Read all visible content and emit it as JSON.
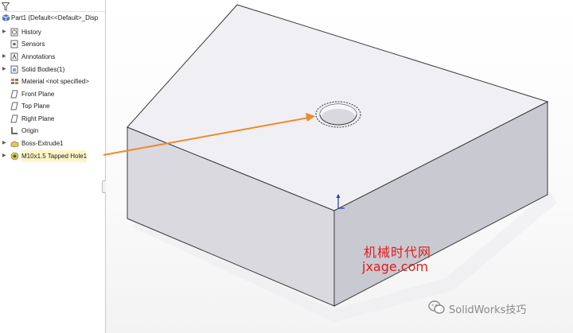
{
  "feature_tree": {
    "root_label": "Part1  (Default<<Default>_Disp",
    "items": [
      {
        "label": "History",
        "icon": "history-icon",
        "expandable": true
      },
      {
        "label": "Sensors",
        "icon": "sensors-icon",
        "expandable": false
      },
      {
        "label": "Annotations",
        "icon": "annotations-icon",
        "expandable": true
      },
      {
        "label": "Solid Bodies(1)",
        "icon": "solid-bodies-icon",
        "expandable": true
      },
      {
        "label": "Material <not specified>",
        "icon": "material-icon",
        "expandable": false
      },
      {
        "label": "Front Plane",
        "icon": "plane-icon",
        "expandable": false
      },
      {
        "label": "Top Plane",
        "icon": "plane-icon",
        "expandable": false
      },
      {
        "label": "Right Plane",
        "icon": "plane-icon",
        "expandable": false
      },
      {
        "label": "Origin",
        "icon": "origin-icon",
        "expandable": false
      },
      {
        "label": "Boss-Extrude1",
        "icon": "boss-extrude-icon",
        "expandable": true
      },
      {
        "label": "M10x1.5 Tapped Hole1",
        "icon": "tapped-hole-icon",
        "expandable": true
      }
    ]
  },
  "watermark": {
    "site_cn": "机械时代网",
    "site_url": "jxage.com"
  },
  "brand": {
    "text": "SolidWorks技巧"
  },
  "colors": {
    "arrow": "#f08a2a",
    "watermark": "#e21b1b",
    "part_top": "#f2f2f5",
    "part_front": "#dcdce3",
    "part_right": "#c8c8d0"
  }
}
